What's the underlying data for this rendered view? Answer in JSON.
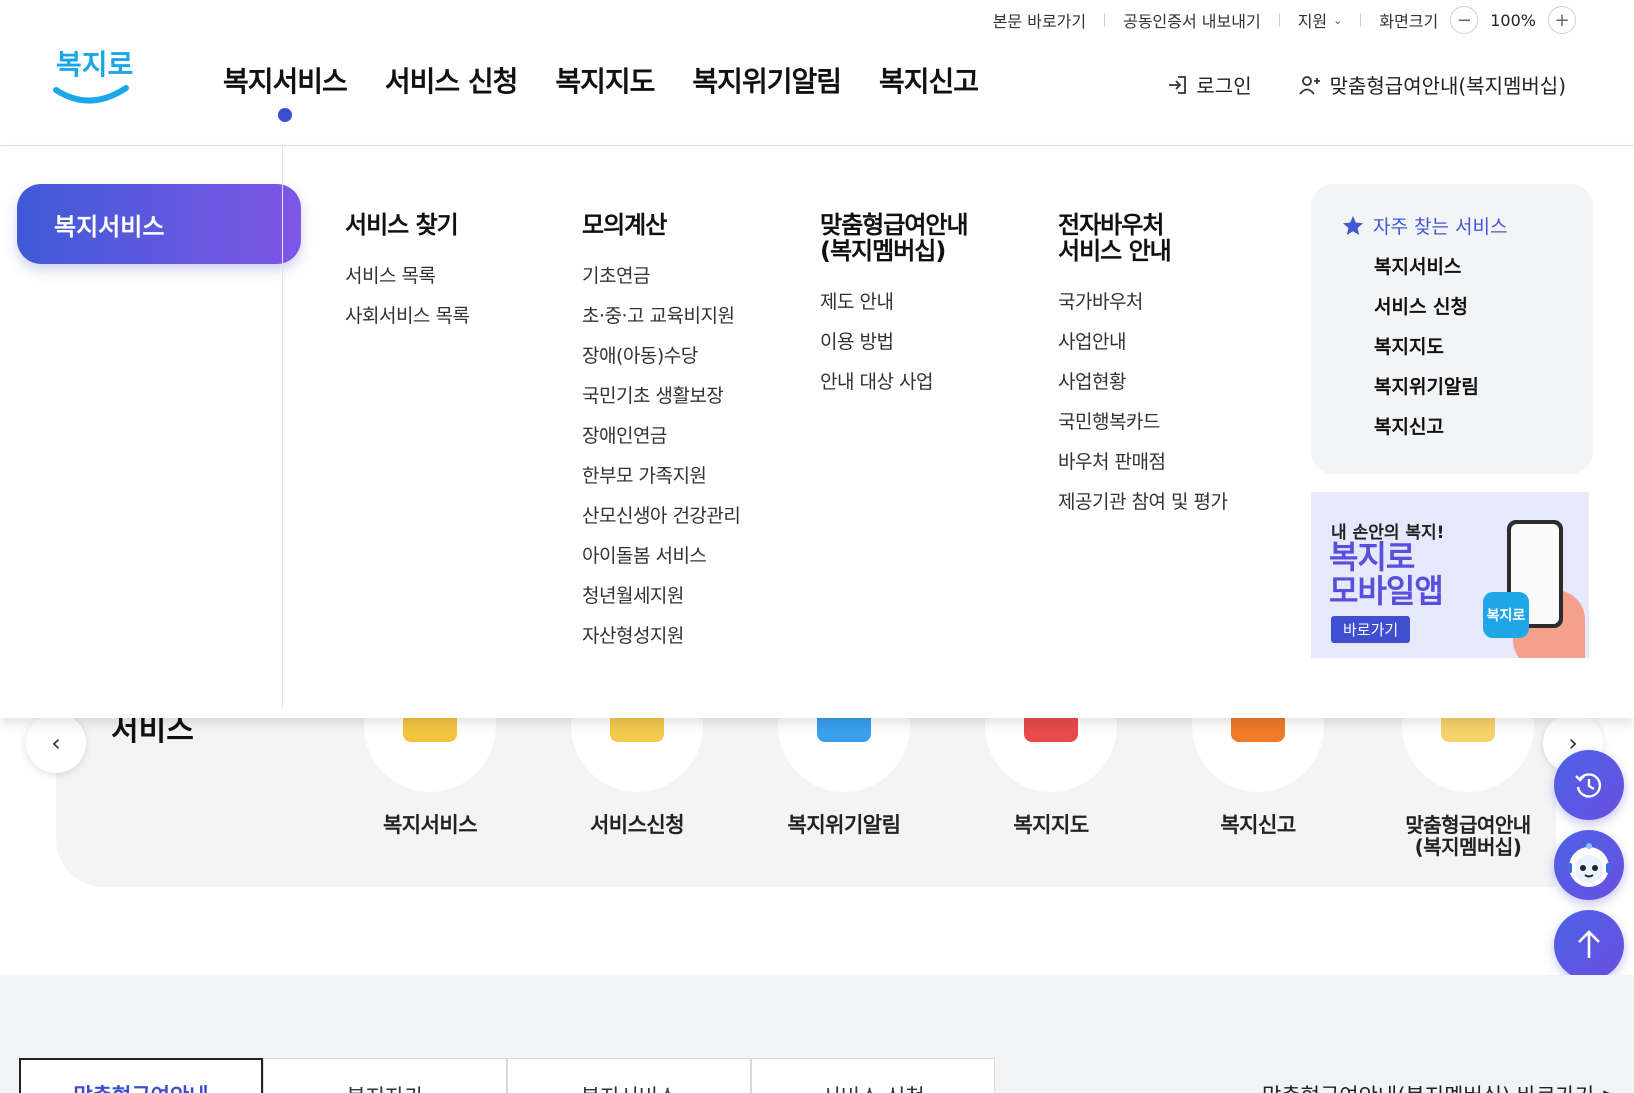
{
  "utility": {
    "skip_to_content": "본문 바로가기",
    "export_cert": "공동인증서 내보내기",
    "support": "지원",
    "screen_size": "화면크기",
    "zoom_out": "−",
    "zoom_level": "100%",
    "zoom_in": "+"
  },
  "logo": {
    "text": "복지로",
    "icon": "smile-logo"
  },
  "gnb": [
    {
      "label": "복지서비스",
      "active": true
    },
    {
      "label": "서비스 신청"
    },
    {
      "label": "복지지도"
    },
    {
      "label": "복지위기알림"
    },
    {
      "label": "복지신고"
    }
  ],
  "header_right": {
    "login": "로그인",
    "login_icon": "login-icon",
    "membership": "맞춤형급여안내(복지멤버십)",
    "membership_icon": "user-plus-icon"
  },
  "mega_menu": {
    "pill": "복지서비스",
    "columns": [
      {
        "title": "서비스 찾기",
        "items": [
          "서비스 목록",
          "사회서비스 목록"
        ]
      },
      {
        "title": "모의계산",
        "items": [
          "기초연금",
          "초·중·고 교육비지원",
          "장애(아동)수당",
          "국민기초 생활보장",
          "장애인연금",
          "한부모 가족지원",
          "산모신생아 건강관리",
          "아이돌봄 서비스",
          "청년월세지원",
          "자산형성지원"
        ]
      },
      {
        "title": "맞춤형급여안내\n(복지멤버십)",
        "items": [
          "제도 안내",
          "이용 방법",
          "안내 대상 사업"
        ]
      },
      {
        "title": "전자바우처\n서비스 안내",
        "items": [
          "국가바우처",
          "사업안내",
          "사업현황",
          "국민행복카드",
          "바우처 판매점",
          "제공기관 참여 및 평가"
        ]
      }
    ],
    "favorites": {
      "title": "자주 찾는 서비스",
      "icon": "star-icon",
      "items": [
        "복지서비스",
        "서비스 신청",
        "복지지도",
        "복지위기알림",
        "복지신고"
      ]
    },
    "banner": {
      "line1": "내 손안의 복지!",
      "line2": "복지로",
      "line3": "모바일앱",
      "button": "바로가기",
      "app_label": "복지로"
    }
  },
  "quick": {
    "heading": "서비스",
    "prev_icon": "chevron-left-icon",
    "next_icon": "chevron-right-icon",
    "items": [
      {
        "label": "복지서비스",
        "color": "#f5c542"
      },
      {
        "label": "서비스신청",
        "color": "#f2c94c"
      },
      {
        "label": "복지위기알림",
        "color": "#3aa0ee"
      },
      {
        "label": "복지지도",
        "color": "#e84a4a"
      },
      {
        "label": "복지신고",
        "color": "#f07a2a"
      },
      {
        "label": "맞춤형급여안내\n(복지멤버십)",
        "color": "#f7d26a"
      }
    ]
  },
  "floating": {
    "recent": "history-icon",
    "chatbot": "chatbot-icon",
    "top": "arrow-up-icon",
    "bottom": "arrow-down-icon"
  },
  "bottom": {
    "tabs": [
      "맞춤형급여안내",
      "복지자가",
      "복지서비스",
      "서비스 신청"
    ],
    "link": "맞춤형급여안내(복지멤버십) 바로가기 >"
  },
  "colors": {
    "accent": "#3a4fd0",
    "pill_start": "#3e5ad6",
    "pill_end": "#7f56e6"
  }
}
